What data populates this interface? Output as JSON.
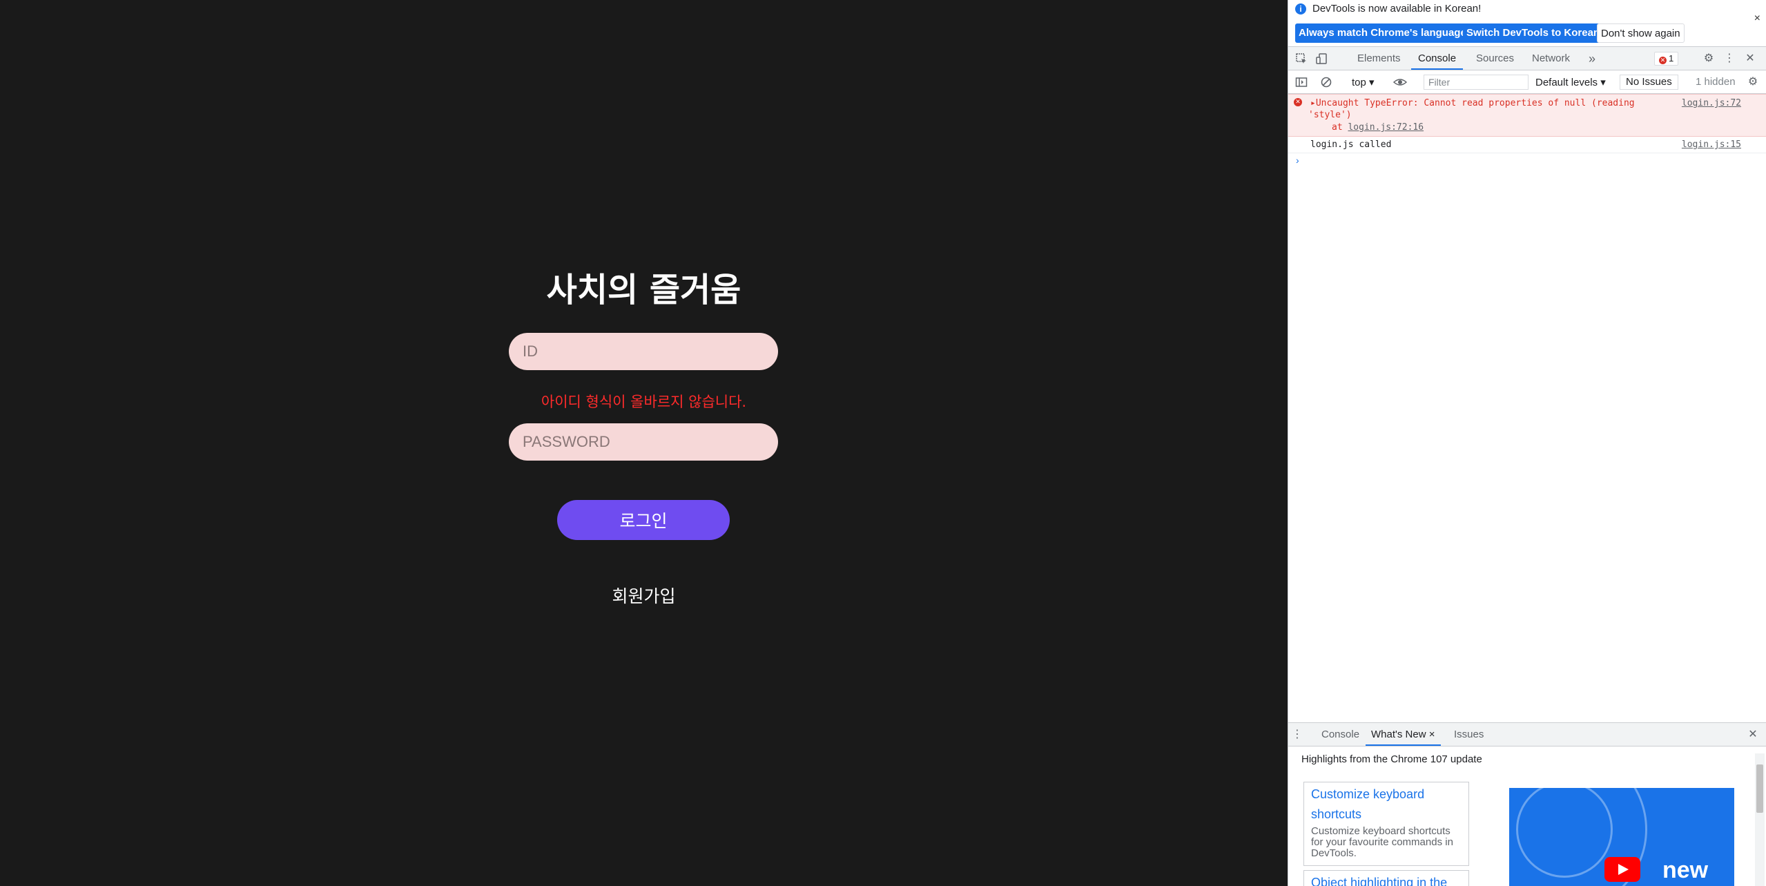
{
  "login": {
    "title": "사치의 즐거움",
    "id_placeholder": "ID",
    "id_error": "아이디 형식이 올바르지 않습니다.",
    "password_placeholder": "PASSWORD",
    "login_button": "로그인",
    "signup_link": "회원가입"
  },
  "colors": {
    "background": "#1a1a1a",
    "input_bg": "#f6d8d8",
    "error_text": "#ff2b2b",
    "button_bg": "#6f4cf0",
    "devtools_accent": "#1a73e8"
  },
  "devtools": {
    "infobar": {
      "message": "DevTools is now available in Korean!",
      "btn_match": "Always match Chrome's language",
      "btn_switch": "Switch DevTools to Korean",
      "btn_dismiss": "Don't show again",
      "close": "×"
    },
    "tabs": [
      "Elements",
      "Console",
      "Sources",
      "Network"
    ],
    "more_tabs": "»",
    "error_count": "1",
    "toolbar": {
      "context": "top ▾",
      "filter_placeholder": "Filter",
      "levels": "Default levels ▾",
      "issues": "No Issues",
      "hidden": "1 hidden"
    },
    "console": {
      "error_line1": "▸Uncaught TypeError: Cannot read properties of null (reading",
      "error_line2": "'style')",
      "error_at": "at ",
      "error_at_link": "login.js:72:16",
      "error_source": "login.js:72",
      "log_text": "login.js called",
      "log_source": "login.js:15",
      "prompt": "›"
    },
    "drawer": {
      "tabs": [
        "Console",
        "What's New",
        "Issues"
      ],
      "whats_new_close": "×",
      "highlights": "Highlights from the Chrome 107 update",
      "card1_title": "Customize keyboard shortcuts",
      "card1_desc": "Customize keyboard shortcuts for your favourite commands in DevTools.",
      "card2_title": "Object highlighting in the",
      "video_word": "new"
    }
  }
}
